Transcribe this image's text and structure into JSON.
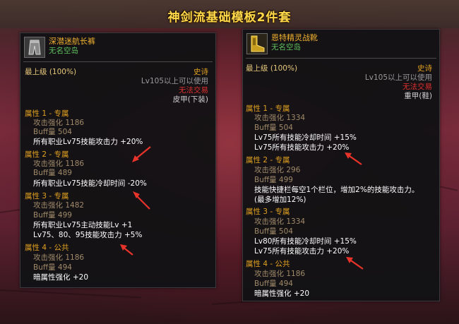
{
  "page_title": "神剑流基础模板2件套",
  "left": {
    "name": "深潜迷航长裤",
    "sub": "无名空岛",
    "grade": "最上级 (100%)",
    "rarity": "史诗",
    "req": "Lv105以上可以使用",
    "untrade": "无法交易",
    "slot": "皮甲(下装)",
    "opt1": {
      "title": "属性 1 - 专属",
      "atk": "攻击强化  1186",
      "buff": "Buff量  504",
      "l1": "所有职业Lv75技能攻击力 +20%"
    },
    "opt2": {
      "title": "属性 2 - 专属",
      "atk": "攻击强化  1186",
      "buff": "Buff量  489",
      "l1": "所有职业Lv75技能冷却时间 -20%"
    },
    "opt3": {
      "title": "属性 3 - 专属",
      "atk": "攻击强化  1482",
      "buff": "Buff量  499",
      "l1": "所有职业Lv75主动技能Lv +1",
      "l2": "Lv75、80、95技能攻击力 +5%"
    },
    "opt4": {
      "title": "属性 4 - 公共",
      "atk": "攻击强化  1186",
      "buff": "Buff量  494",
      "l1": "暗属性强化 +20"
    }
  },
  "right": {
    "name": "恩特精灵战靴",
    "sub": "无名空岛",
    "grade": "最上级 (100%)",
    "rarity": "史诗",
    "req": "Lv105以上可以使用",
    "untrade": "无法交易",
    "slot": "重甲(鞋)",
    "opt1": {
      "title": "属性 1 - 专属",
      "atk": "攻击强化  1334",
      "buff": "Buff量  504",
      "l1": "Lv75所有技能冷却时间 +15%",
      "l2": "Lv75所有技能攻击力 +20%"
    },
    "opt2": {
      "title": "属性 2 - 专属",
      "atk": "攻击强化  296",
      "buff": "Buff量  499",
      "l1": "技能快捷栏每空1个栏位，增加2%的技能攻击力。",
      "l2": "(最多增加12%)"
    },
    "opt3": {
      "title": "属性 3 - 专属",
      "atk": "攻击强化  1334",
      "buff": "Buff量  504",
      "l1": "Lv80所有技能冷却时间 +15%",
      "l2": "Lv75所有技能攻击力 +20%"
    },
    "opt4": {
      "title": "属性 4 - 公共",
      "atk": "攻击强化  1186",
      "buff": "Buff量  494",
      "l1": "暗属性强化 +20"
    }
  },
  "arrow_color": "#e8332a",
  "icons": {
    "left_item": "pants-armor-icon",
    "right_item": "golden-boots-icon",
    "annotation": "red-arrow-icon"
  }
}
